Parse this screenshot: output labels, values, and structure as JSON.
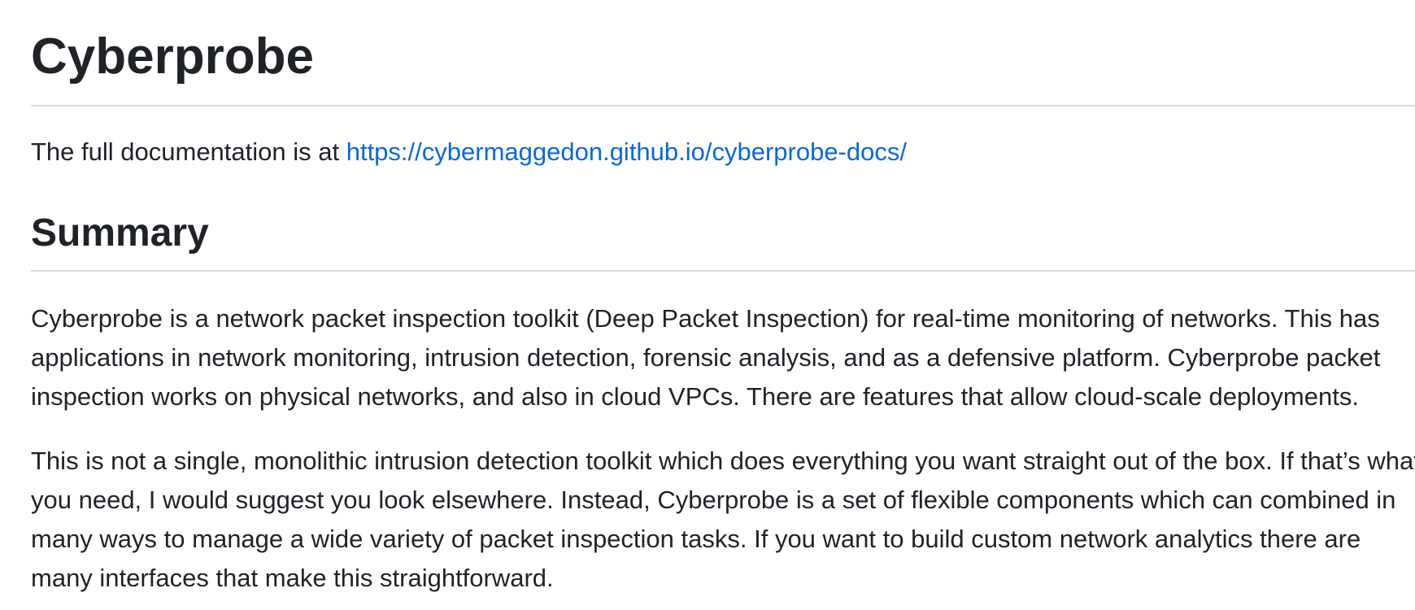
{
  "document": {
    "title": "Cyberprobe",
    "intro_text": "The full documentation is at ",
    "doc_link": "https://cybermaggedon.github.io/cyberprobe-docs/",
    "summary_heading": "Summary",
    "summary_paragraph_1": [
      "Cyberprobe is a network packet inspection toolkit (Deep Packet Inspection) for real-time monitoring of networks. This has",
      "applications in network monitoring, intrusion detection, forensic analysis, and as a defensive platform. Cyberprobe packet",
      "inspection works on physical networks, and also in cloud VPCs. There are features that allow cloud-scale deployments."
    ],
    "summary_paragraph_2": [
      "This is not a single, monolithic intrusion detection toolkit which does everything you want straight out of the box. If that’s what",
      "you need, I would suggest you look elsewhere. Instead, Cyberprobe is a set of flexible components which can combined in",
      "many ways to manage a wide variety of packet inspection tasks. If you want to build custom network analytics there are",
      "many interfaces that make this straightforward."
    ]
  },
  "colors": {
    "text": "#1f2328",
    "link": "#0969da",
    "rule": "#d8dee4",
    "background": "#ffffff"
  }
}
